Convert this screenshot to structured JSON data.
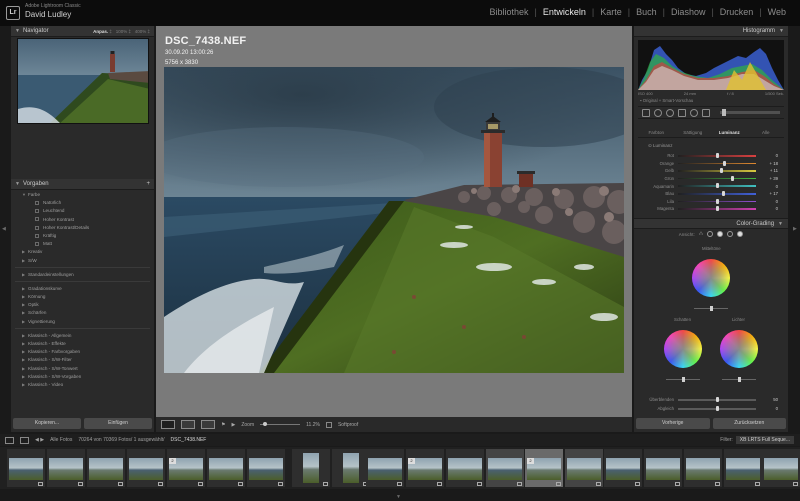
{
  "app": {
    "product": "Adobe Lightroom Classic",
    "user": "David Ludley"
  },
  "modules": [
    {
      "label": "Bibliothek",
      "active": false
    },
    {
      "label": "Entwickeln",
      "active": true
    },
    {
      "label": "Karte",
      "active": false
    },
    {
      "label": "Buch",
      "active": false
    },
    {
      "label": "Diashow",
      "active": false
    },
    {
      "label": "Drucken",
      "active": false
    },
    {
      "label": "Web",
      "active": false
    }
  ],
  "navigator": {
    "title": "Navigator",
    "zoom_options": [
      "Anpas.",
      "100%",
      "400%"
    ],
    "zoom_selected": "Anpas."
  },
  "presets": {
    "title": "Vorgaben",
    "items": [
      {
        "label": "Farbe",
        "level": 1,
        "open": true
      },
      {
        "label": "Natürlich",
        "level": 2
      },
      {
        "label": "Leuchtend",
        "level": 2
      },
      {
        "label": "Hoher Kontrast",
        "level": 2
      },
      {
        "label": "Hoher Kontrast/Details",
        "level": 2
      },
      {
        "label": "Kräftig",
        "level": 2
      },
      {
        "label": "Matt",
        "level": 2
      },
      {
        "label": "Kreativ",
        "level": 1,
        "open": false
      },
      {
        "label": "S/W",
        "level": 1,
        "open": false
      },
      {
        "gap": true
      },
      {
        "label": "Standardeinstellungen",
        "level": 1,
        "open": false
      },
      {
        "gap": true
      },
      {
        "label": "Gradationskurve",
        "level": 1,
        "open": false
      },
      {
        "label": "Körnung",
        "level": 1,
        "open": false
      },
      {
        "label": "Optik",
        "level": 1,
        "open": false
      },
      {
        "label": "Schärfen",
        "level": 1,
        "open": false
      },
      {
        "label": "Vignettierung",
        "level": 1,
        "open": false
      },
      {
        "gap": true
      },
      {
        "label": "Klassisch - Allgemein",
        "level": 1,
        "open": false
      },
      {
        "label": "Klassisch - Effekte",
        "level": 1,
        "open": false
      },
      {
        "label": "Klassisch - Farbvorgaben",
        "level": 1,
        "open": false
      },
      {
        "label": "Klassisch - S/W-Filter",
        "level": 1,
        "open": false
      },
      {
        "label": "Klassisch - S/W-Tonwert",
        "level": 1,
        "open": false
      },
      {
        "label": "Klassisch - S/W-Vorgaben",
        "level": 1,
        "open": false
      },
      {
        "label": "Klassisch - Video",
        "level": 1,
        "open": false
      }
    ]
  },
  "left_buttons": {
    "copy": "Kopieren...",
    "paste": "Einfügen"
  },
  "photo": {
    "filename": "DSC_7438.NEF",
    "datetime": "30.09.20 13:00:26",
    "dimensions": "5756 x 3830"
  },
  "toolbar": {
    "zoom_label": "Zoom",
    "zoom_value": "11.2%",
    "softproof": "Softproof"
  },
  "histogram": {
    "title": "Histogramm",
    "iso": "ISO 400",
    "focal": "24 mm",
    "aperture": "f / 8",
    "shutter": "1/500 Sek.",
    "original": "Original + Smart-Vorschau"
  },
  "hsl": {
    "tabs": [
      "Farbton",
      "Sättigung",
      "Luminanz",
      "Alle"
    ],
    "active_tab": "Luminanz",
    "section": "Luminanz",
    "sliders": [
      {
        "label": "Rot",
        "value": "0",
        "pos": 0.5
      },
      {
        "label": "Orange",
        "value": "+ 18",
        "pos": 0.59
      },
      {
        "label": "Gelb",
        "value": "+ 11",
        "pos": 0.555
      },
      {
        "label": "Grün",
        "value": "+ 39",
        "pos": 0.695
      },
      {
        "label": "Aquamarin",
        "value": "0",
        "pos": 0.5
      },
      {
        "label": "Blau",
        "value": "+ 17",
        "pos": 0.585
      },
      {
        "label": "Lila",
        "value": "0",
        "pos": 0.5
      },
      {
        "label": "Magenta",
        "value": "0",
        "pos": 0.5
      }
    ]
  },
  "color_grading": {
    "title": "Color-Grading",
    "view_label": "Ansicht:",
    "midtones": "Mitteltöne",
    "shadows": "Schatten",
    "highlights": "Lichter",
    "blending_label": "Überblenden",
    "blending_value": "50",
    "balance_label": "Abgleich",
    "balance_value": "0"
  },
  "right_buttons": {
    "previous": "Vorherige",
    "reset": "Zurücksetzen"
  },
  "filmstrip": {
    "source": "Alle Fotos",
    "count": "70264 von 70369 Fotos/ 1 ausgewählt/",
    "selected_file": "DSC_7438.NEF",
    "filter_label": "Filter:",
    "filter_value": "XB LRTS Full Seque..."
  }
}
